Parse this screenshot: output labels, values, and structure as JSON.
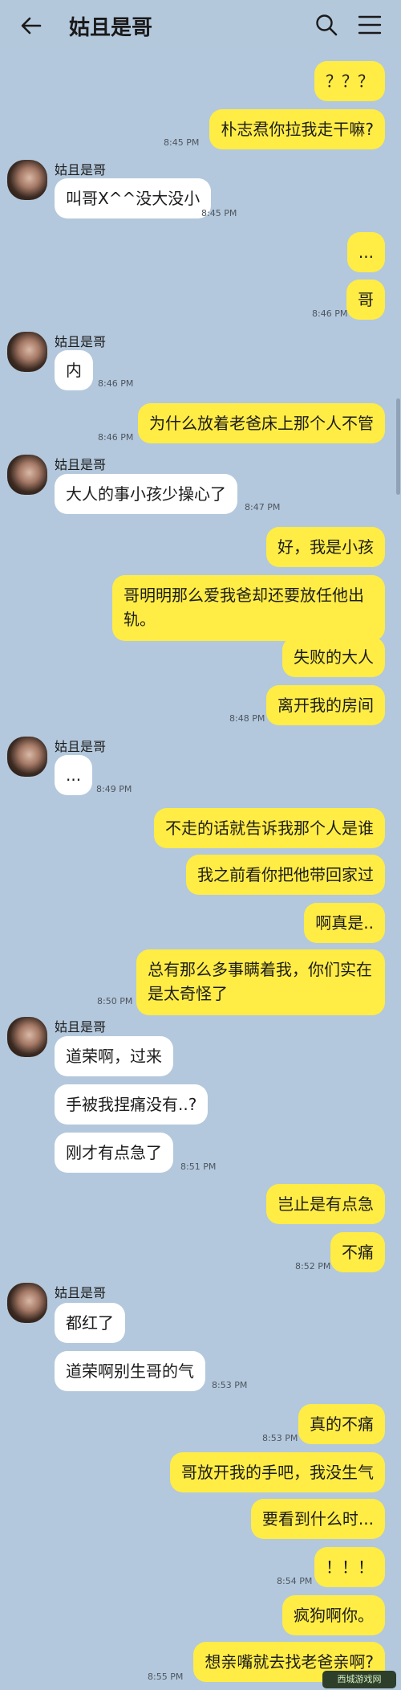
{
  "header": {
    "title": "姑且是哥"
  },
  "contact": {
    "name": "姑且是哥"
  },
  "watermark": "西城游戏网",
  "messages": [
    {
      "text": "？？？"
    },
    {
      "text": "朴志焄你拉我走干嘛?",
      "time": "8:45 PM"
    },
    {
      "text": "叫哥X^^没大没小",
      "time": "8:45 PM"
    },
    {
      "text": "..."
    },
    {
      "text": "哥",
      "time": "8:46 PM"
    },
    {
      "text": "内",
      "time": "8:46 PM"
    },
    {
      "text": "为什么放着老爸床上那个人不管",
      "time": "8:46 PM"
    },
    {
      "text": "大人的事小孩少操心了",
      "time": "8:47 PM"
    },
    {
      "text": "好，我是小孩"
    },
    {
      "text": "哥明明那么爱我爸却还要放任他出轨。"
    },
    {
      "text": "失败的大人"
    },
    {
      "text": "离开我的房间",
      "time": "8:48 PM"
    },
    {
      "text": "...",
      "time": "8:49 PM"
    },
    {
      "text": "不走的话就告诉我那个人是谁"
    },
    {
      "text": "我之前看你把他带回家过"
    },
    {
      "text": "啊真是.."
    },
    {
      "text": "总有那么多事瞒着我，你们实在是太奇怪了",
      "time": "8:50 PM"
    },
    {
      "text": "道荣啊，过来"
    },
    {
      "text": "手被我捏痛没有..?"
    },
    {
      "text": "刚才有点急了",
      "time": "8:51 PM"
    },
    {
      "text": "岂止是有点急"
    },
    {
      "text": "不痛",
      "time": "8:52 PM"
    },
    {
      "text": "都红了"
    },
    {
      "text": "道荣啊别生哥的气",
      "time": "8:53 PM"
    },
    {
      "text": "真的不痛",
      "time": "8:53 PM"
    },
    {
      "text": "哥放开我的手吧，我没生气"
    },
    {
      "text": "要看到什么时..."
    },
    {
      "text": "！！！",
      "time": "8:54 PM"
    },
    {
      "text": "疯狗啊你。"
    },
    {
      "text": "想亲嘴就去找老爸亲啊?",
      "time": "8:55 PM"
    }
  ]
}
